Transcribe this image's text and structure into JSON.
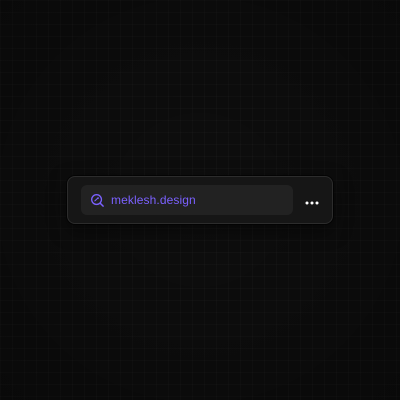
{
  "address_bar": {
    "url": "meklesh.design",
    "search_icon": "search-icon",
    "more_icon": "more-horizontal-icon"
  },
  "colors": {
    "background": "#0e0e0e",
    "bar_background": "#161616",
    "field_background": "#222222",
    "accent": "#7b61ff",
    "more_icon": "#ffffff"
  }
}
